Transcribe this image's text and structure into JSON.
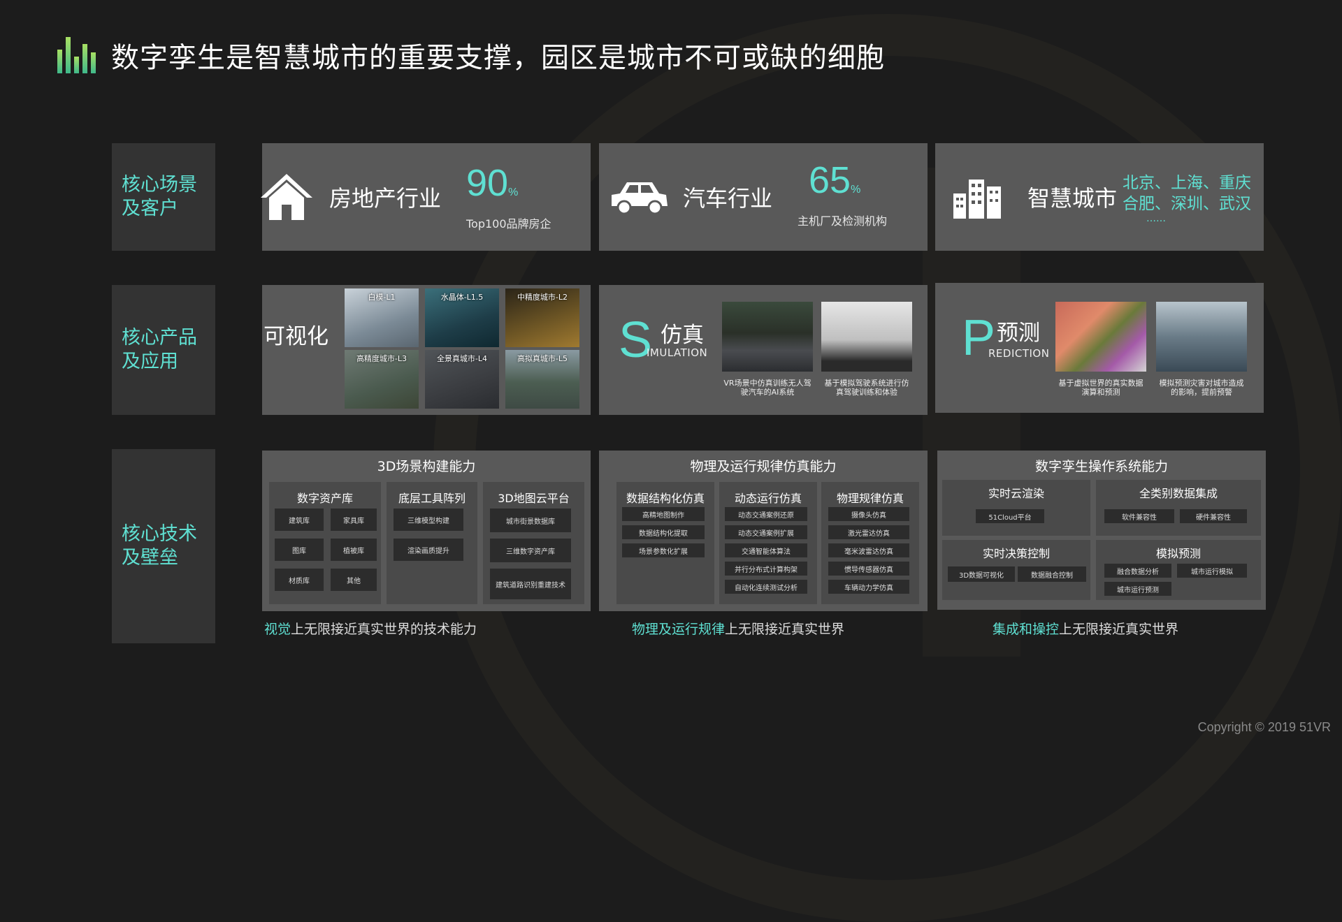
{
  "title": "数字孪生是智慧城市的重要支撑，园区是城市不可或缺的细胞",
  "rows": {
    "scenes": "核心场景\n及客户",
    "products": "核心产品\n及应用",
    "tech": "核心技术\n及壁垒"
  },
  "scenes": [
    {
      "name": "房地产行业",
      "percent": "90",
      "unit": "%",
      "sub": "Top100品牌房企"
    },
    {
      "name": "汽车行业",
      "percent": "65",
      "unit": "%",
      "sub": "主机厂及检测机构"
    },
    {
      "name": "智慧城市",
      "cities_line1": "北京、上海、重庆",
      "cities_line2": "合肥、深圳、武汉",
      "cities_more": "……"
    }
  ],
  "products": {
    "viz": {
      "name": "可视化",
      "thumbs": [
        "白模-L1",
        "水晶体-L1.5",
        "中精度城市-L2",
        "高精度城市-L3",
        "全景真城市-L4",
        "高拟真城市-L5"
      ]
    },
    "sim": {
      "letter": "S",
      "name": "仿真",
      "sub": "IMULATION",
      "captions": [
        "VR场景中仿真训练无人驾驶汽车的AI系统",
        "基于模拟驾驶系统进行仿真驾驶训练和体验"
      ]
    },
    "pred": {
      "letter": "P",
      "name": "预测",
      "sub": "REDICTION",
      "captions": [
        "基于虚拟世界的真实数据演算和预测",
        "模拟预测灾害对城市造成的影响，提前预警"
      ]
    }
  },
  "tech": [
    {
      "title": "3D场景构建能力",
      "columns": [
        {
          "head": "数字资产库",
          "chips": [
            "建筑库",
            "家具库",
            "图库",
            "植被库",
            "材质库",
            "其他"
          ]
        },
        {
          "head": "底层工具阵列",
          "chips": [
            "三维模型构建",
            "渲染画质提升"
          ]
        },
        {
          "head": "3D地图云平台",
          "chips": [
            "城市街景数据库",
            "三维数字资产库",
            "建筑道路识别重建技术"
          ]
        }
      ],
      "foot_hl": "视觉",
      "foot_rest": "上无限接近真实世界的技术能力"
    },
    {
      "title": "物理及运行规律仿真能力",
      "columns": [
        {
          "head": "数据结构化仿真",
          "chips": [
            "高精地图制作",
            "数据结构化提取",
            "场景参数化扩展"
          ]
        },
        {
          "head": "动态运行仿真",
          "chips": [
            "动态交通案例还原",
            "动态交通案例扩展",
            "交通智能体算法",
            "并行分布式计算构架",
            "自动化连续测试分析"
          ]
        },
        {
          "head": "物理规律仿真",
          "chips": [
            "摄像头仿真",
            "激光雷达仿真",
            "毫米波雷达仿真",
            "惯导传感器仿真",
            "车辆动力学仿真"
          ]
        }
      ],
      "foot_hl": "物理及运行规律",
      "foot_rest": "上无限接近真实世界"
    },
    {
      "title": "数字孪生操作系统能力",
      "columns": [
        {
          "head": "实时云渲染",
          "chips": [
            "51Cloud平台"
          ]
        },
        {
          "head": "全类别数据集成",
          "chips": [
            "软件兼容性",
            "硬件兼容性"
          ]
        },
        {
          "head": "实时决策控制",
          "chips": [
            "3D数据可视化",
            "数据融合控制"
          ]
        },
        {
          "head": "模拟预测",
          "chips": [
            "融合数据分析",
            "城市运行模拟",
            "城市运行预测"
          ]
        }
      ],
      "foot_hl": "集成和操控",
      "foot_rest": "上无限接近真实世界"
    }
  ],
  "copyright": "Copyright © 2019 51VR",
  "colors": {
    "accent": "#5fe0d2",
    "card": "#595959",
    "background": "#1c1c1c"
  }
}
